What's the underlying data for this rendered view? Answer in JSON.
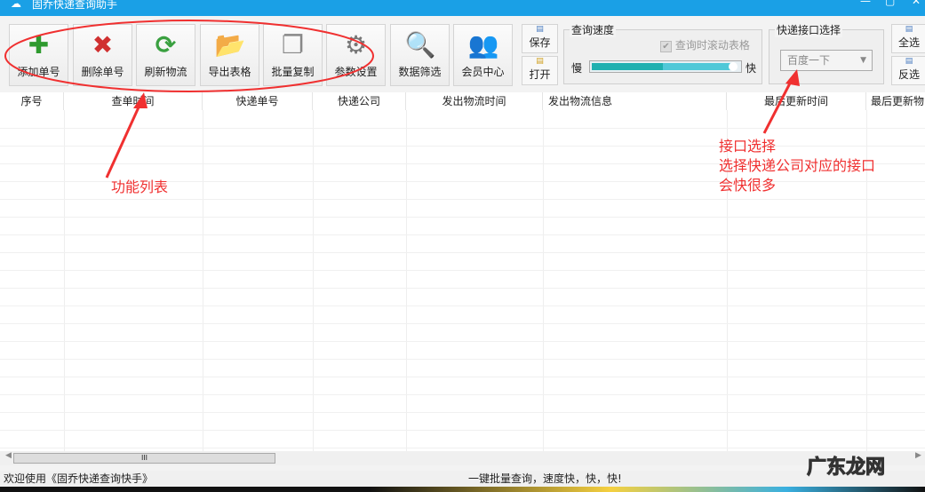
{
  "window": {
    "title": "固乔快递查询助手"
  },
  "toolbar": {
    "buttons": [
      {
        "label": "添加单号",
        "icon": "plus-icon"
      },
      {
        "label": "删除单号",
        "icon": "delete-x-icon"
      },
      {
        "label": "刷新物流",
        "icon": "refresh-icon"
      },
      {
        "label": "导出表格",
        "icon": "folder-export-icon"
      },
      {
        "label": "批量复制",
        "icon": "copy-icon"
      },
      {
        "label": "参数设置",
        "icon": "gear-icon"
      },
      {
        "label": "数据筛选",
        "icon": "search-folder-icon"
      },
      {
        "label": "会员中心",
        "icon": "users-icon"
      }
    ],
    "save": "保存",
    "open": "打开",
    "select_all": "全选",
    "invert": "反选"
  },
  "speed": {
    "title": "查询速度",
    "scroll_checkbox": "查询时滚动表格",
    "checked": true,
    "slow": "慢",
    "fast": "快",
    "value_percent": 100
  },
  "interface": {
    "title": "快递接口选择",
    "selected": "百度一下"
  },
  "table": {
    "columns": [
      "序号",
      "查单时间",
      "快递单号",
      "快递公司",
      "发出物流时间",
      "发出物流信息",
      "最后更新时间",
      "最后更新物"
    ]
  },
  "scrollbar": {
    "thumb": "III"
  },
  "status": {
    "left": "欢迎使用《固乔快递查询快手》",
    "right": "一键批量查询，速度快，快，快!"
  },
  "annotations": {
    "features": "功能列表",
    "interface_line1": "接口选择",
    "interface_line2": "选择快递公司对应的接口",
    "interface_line3": "会快很多"
  },
  "watermark": "广东龙网"
}
